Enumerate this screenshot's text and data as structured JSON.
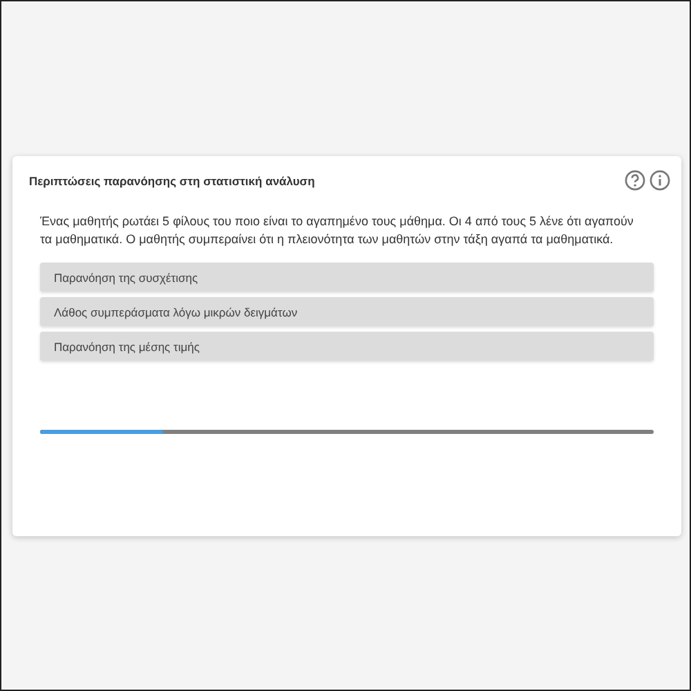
{
  "card": {
    "title": "Περιπτώσεις παρανόησης στη στατιστική ανάλυση",
    "question": "Ένας μαθητής ρωτάει 5 φίλους του ποιο είναι το αγαπημένο τους μάθημα.  Οι 4 από τους 5 λένε ότι αγαπούν τα μαθηματικά. Ο μαθητής συμπεραίνει ότι η πλειονότητα των μαθητών στην τάξη αγαπά τα μαθηματικά.",
    "options": [
      {
        "label": "Παρανόηση της συσχέτισης"
      },
      {
        "label": "Λάθος συμπεράσματα λόγω μικρών δειγμάτων"
      },
      {
        "label": "Παρανόηση της μέσης τιμής"
      }
    ],
    "progress": {
      "level": 0.2
    }
  }
}
